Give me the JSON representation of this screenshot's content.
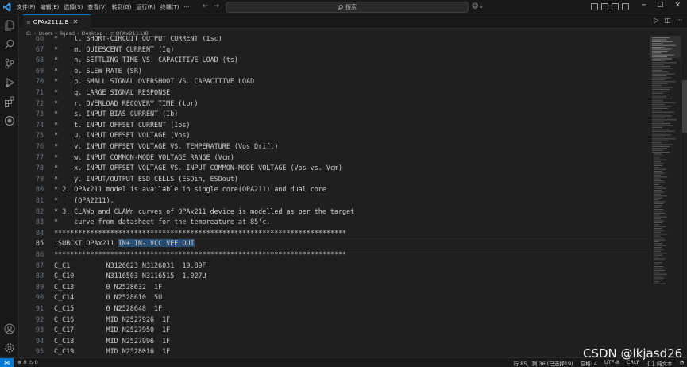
{
  "titlebar": {
    "menu": [
      "文件(F)",
      "编辑(E)",
      "选择(S)",
      "查看(V)",
      "转到(G)",
      "运行(R)",
      "终端(T)",
      "···"
    ],
    "search_placeholder": "搜索",
    "nav_back": "←",
    "nav_forward": "→",
    "search_icon": "magnifier-icon",
    "accent": "#0078d4"
  },
  "tab": {
    "label": "OPAx211.LIB",
    "close": "✕"
  },
  "breadcrumb": [
    "C:",
    "Users",
    "lkjasd",
    "Desktop",
    "OPAx211.LIB"
  ],
  "editor": {
    "current_line": 85,
    "lines": [
      {
        "n": "66",
        "text": "*    l. SHORT-CIRCUIT OUTPUT CURRENT (Isc)"
      },
      {
        "n": "67",
        "text": "*    m. QUIESCENT CURRENT (Iq)"
      },
      {
        "n": "68",
        "text": "*    n. SETTLING TIME VS. CAPACITIVE LOAD (ts)"
      },
      {
        "n": "69",
        "text": "*    o. SLEW RATE (SR)"
      },
      {
        "n": "70",
        "text": "*    p. SMALL SIGNAL OVERSHOOT VS. CAPACITIVE LOAD"
      },
      {
        "n": "71",
        "text": "*    q. LARGE SIGNAL RESPONSE"
      },
      {
        "n": "72",
        "text": "*    r. OVERLOAD RECOVERY TIME (tor)"
      },
      {
        "n": "73",
        "text": "*    s. INPUT BIAS CURRENT (Ib)"
      },
      {
        "n": "74",
        "text": "*    t. INPUT OFFSET CURRENT (Ios)"
      },
      {
        "n": "75",
        "text": "*    u. INPUT OFFSET VOLTAGE (Vos)"
      },
      {
        "n": "76",
        "text": "*    v. INPUT OFFSET VOLTAGE VS. TEMPERATURE (Vos Drift)"
      },
      {
        "n": "77",
        "text": "*    w. INPUT COMMON-MODE VOLTAGE RANGE (Vcm)"
      },
      {
        "n": "78",
        "text": "*    x. INPUT OFFSET VOLTAGE VS. INPUT COMMON-MODE VOLTAGE (Vos vs. Vcm)"
      },
      {
        "n": "79",
        "text": "*    y. INPUT/OUTPUT ESD CELLS (ESDin, ESDout)"
      },
      {
        "n": "80",
        "text": "* 2. OPAx211 model is available in single core(OPA211) and dual core"
      },
      {
        "n": "81",
        "text": "*    (OPA2211)."
      },
      {
        "n": "82",
        "text": "* 3. CLAWp and CLAWn curves of OPAx211 device is modelled as per the target"
      },
      {
        "n": "83",
        "text": "*    curve from datasheet for the tempreature at 85'c."
      },
      {
        "n": "84",
        "text": "*************************************************************************"
      },
      {
        "n": "85",
        "text": ".SUBCKT OPAx211 ",
        "selected": "IN+ IN- VCC VEE OUT"
      },
      {
        "n": "86",
        "text": "*************************************************************************"
      },
      {
        "n": "87",
        "text": "C_C1         N3126023 N3126031  19.89F"
      },
      {
        "n": "88",
        "text": "C_C10        N3116503 N3116515  1.027U"
      },
      {
        "n": "89",
        "text": "C_C13        0 N2528632  1F"
      },
      {
        "n": "90",
        "text": "C_C14        0 N2528610  5U"
      },
      {
        "n": "91",
        "text": "C_C15        0 N2528648  1F"
      },
      {
        "n": "92",
        "text": "C_C16        MID N2527926  1F"
      },
      {
        "n": "93",
        "text": "C_C17        MID N2527950  1F"
      },
      {
        "n": "94",
        "text": "C_C18        MID N2527996  1F"
      },
      {
        "n": "95",
        "text": "C_C19        MID N2528016  1F"
      }
    ]
  },
  "statusbar": {
    "remote_icon": "remote-icon",
    "problems": "⊗ 0 ⚠ 0",
    "position": "行 85，列 36 (已选择19)",
    "spaces": "空格: 4",
    "encoding": "UTF-8",
    "eol": "CRLF",
    "language": "{ } 纯文本",
    "bell": "🔔"
  },
  "watermark": "CSDN @lkjasd26"
}
